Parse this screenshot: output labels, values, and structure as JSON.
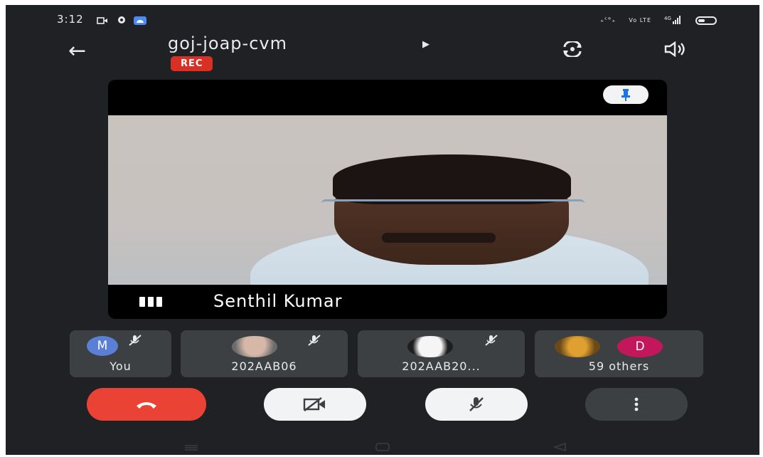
{
  "status_bar": {
    "time": "3:12",
    "net_text_1": "₊ᶜᵊ₊",
    "net_text_2": "Vo LTE",
    "signal_text": "⁴ᴳ",
    "icons": [
      "video-call-icon",
      "settings-icon",
      "cloud-icon",
      "data-activity-icon",
      "signal-icon",
      "battery-icon"
    ]
  },
  "header": {
    "meeting_code": "goj-joap-cvm",
    "rec_label": "REC"
  },
  "main_speaker": {
    "name": "Senthil Kumar"
  },
  "participants": [
    {
      "label": "You",
      "avatar_letter": "M",
      "avatar_color": "#5b7fd4",
      "muted": true
    },
    {
      "label": "202AAB06",
      "avatar": "photo",
      "muted": true
    },
    {
      "label": "202AAB20...",
      "avatar": "logo",
      "muted": true
    },
    {
      "label": "59 others",
      "avatar_letter": "D",
      "avatar_color": "#c2185b",
      "muted": false
    }
  ],
  "colors": {
    "background": "#202124",
    "tile": "#3c4043",
    "end_call": "#ea4335",
    "rec": "#d93025"
  }
}
